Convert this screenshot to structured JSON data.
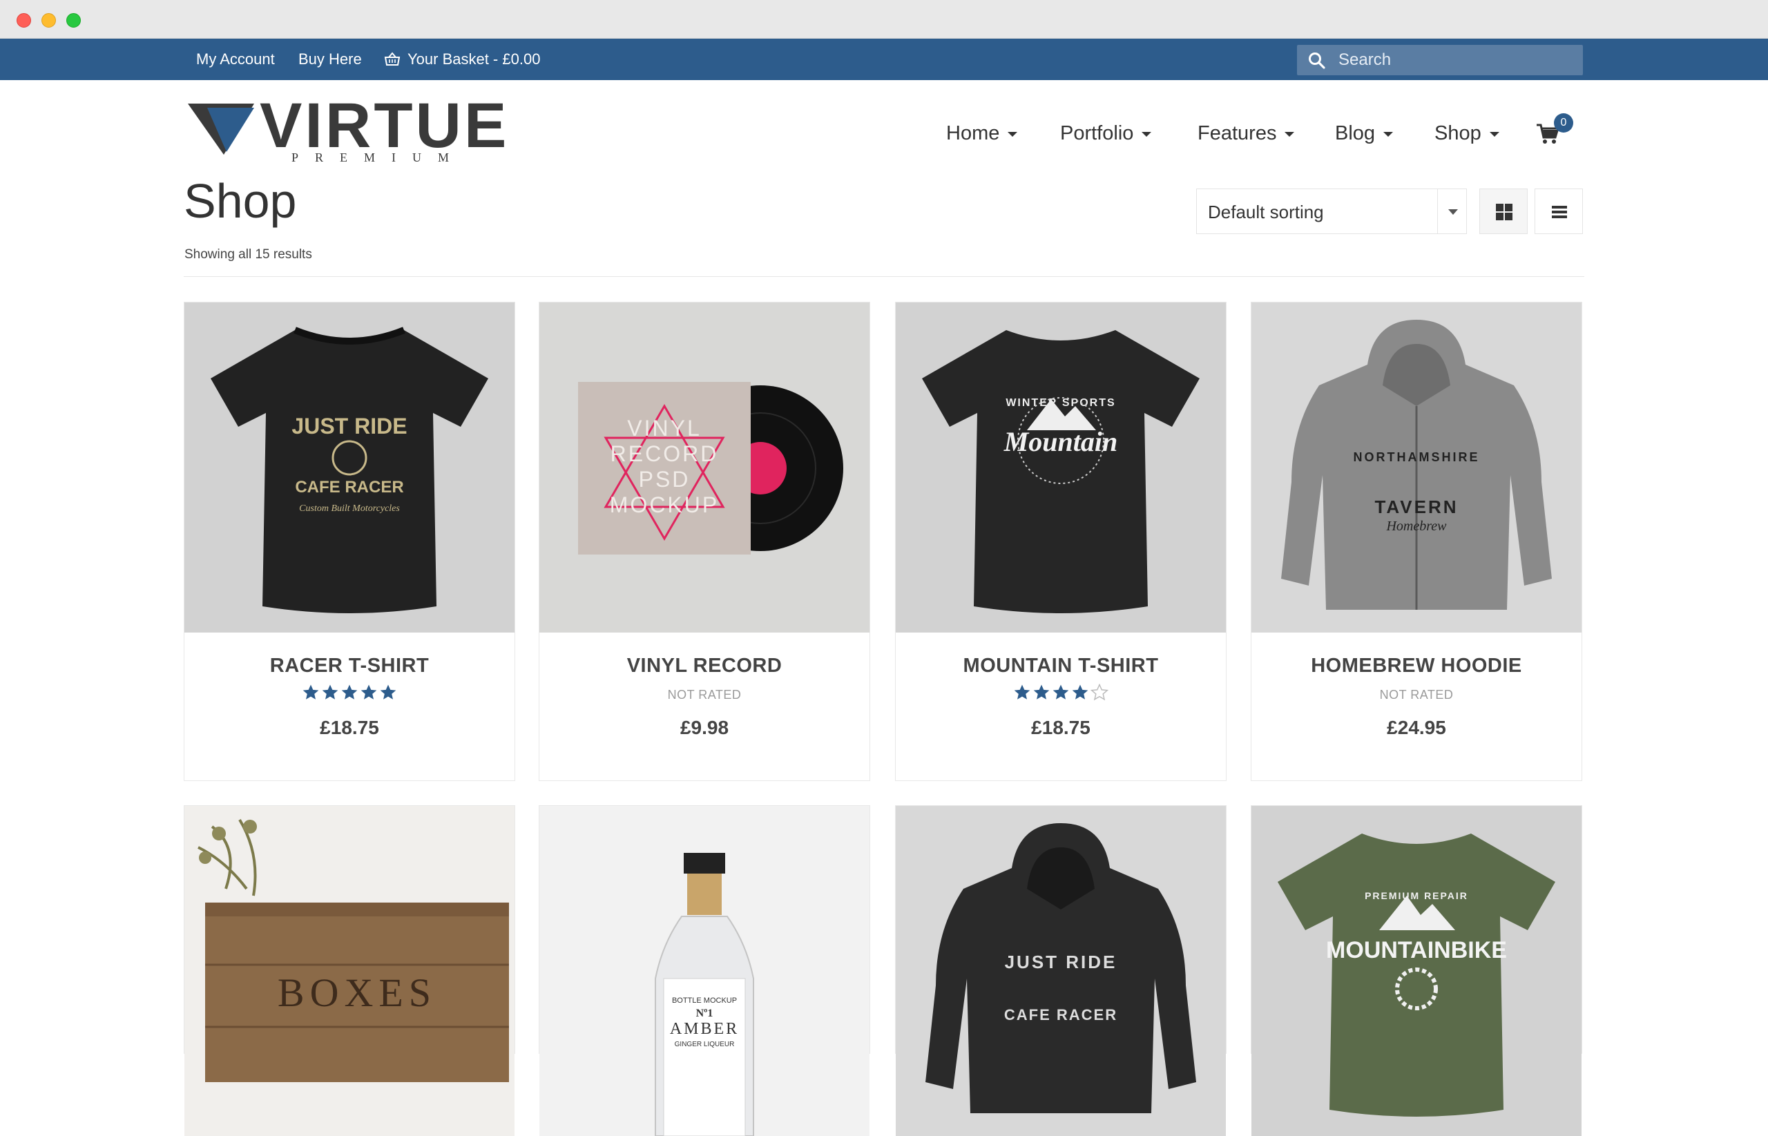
{
  "topbar": {
    "links": [
      "My Account",
      "Buy Here"
    ],
    "basket_label": "Your Basket - £0.00",
    "search_placeholder": "Search"
  },
  "logo": {
    "title": "VIRTUE",
    "subtitle": "PREMIUM"
  },
  "nav": {
    "items": [
      "Home",
      "Portfolio",
      "Features",
      "Blog",
      "Shop"
    ],
    "cart_count": "0"
  },
  "shop": {
    "title": "Shop",
    "result_count": "Showing all 15 results",
    "sorting_selected": "Default sorting"
  },
  "products": [
    {
      "name": "RACER T-SHIRT",
      "rating": 5,
      "rated": true,
      "price": "£18.75",
      "image_text": [
        "JUST RIDE",
        "CAFE RACER",
        "Custom Built Motorcycles"
      ]
    },
    {
      "name": "VINYL RECORD",
      "rating": 0,
      "rated": false,
      "not_rated_label": "NOT RATED",
      "price": "£9.98",
      "image_text": [
        "VINYL",
        "RECORD",
        "PSD",
        "MOCKUP"
      ]
    },
    {
      "name": "MOUNTAIN T-SHIRT",
      "rating": 4,
      "rated": true,
      "price": "£18.75",
      "image_text": [
        "WINTER SPORTS",
        "Mountain"
      ]
    },
    {
      "name": "HOMEBREW HOODIE",
      "rating": 0,
      "rated": false,
      "not_rated_label": "NOT RATED",
      "price": "£24.95",
      "image_text": [
        "NORTHAMSHIRE",
        "TAVERN",
        "Homebrew"
      ]
    },
    {
      "name": "",
      "image_text": [
        "BOXES"
      ]
    },
    {
      "name": "",
      "image_text": [
        "BOTTLE MOCKUP",
        "Nº1",
        "AMBER",
        "GINGER LIQUEUR"
      ]
    },
    {
      "name": "",
      "image_text": [
        "JUST RIDE",
        "CAFE RACER"
      ]
    },
    {
      "name": "",
      "image_text": [
        "PREMIUM REPAIR",
        "MOUNTAINBIKE"
      ]
    }
  ],
  "colors": {
    "topbar": "#2d5c8c",
    "star": "#2d5c8c",
    "text": "#333333"
  }
}
